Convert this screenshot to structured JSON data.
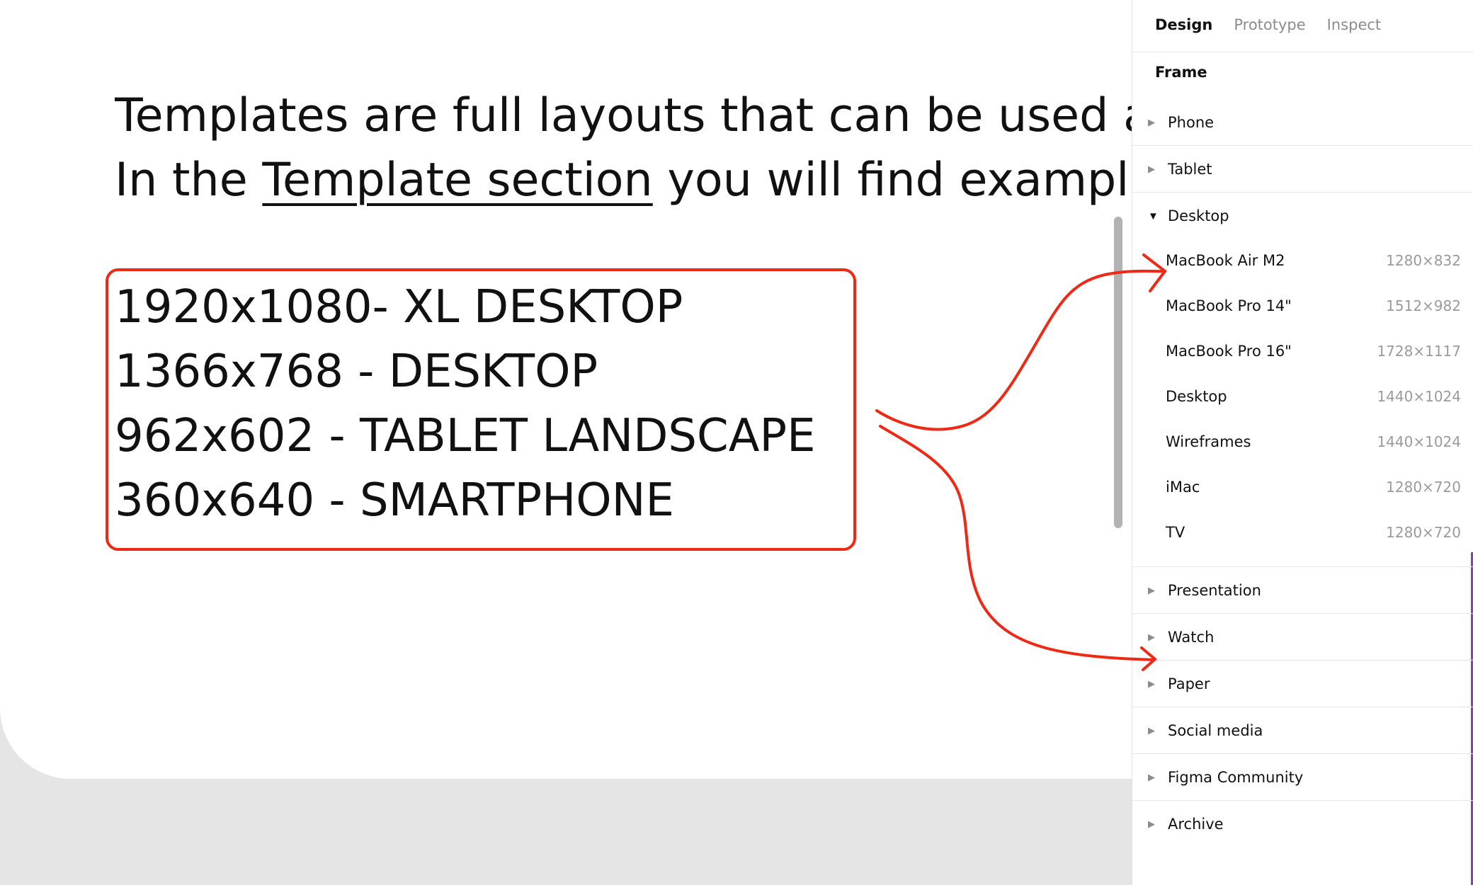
{
  "canvas": {
    "intro_line1": "Templates are full layouts that can be used as",
    "intro_line2_prefix": "In the ",
    "intro_link": "Template section",
    "intro_line2_suffix": " you will find examples",
    "resolutions": [
      "1920x1080- XL DESKTOP",
      "1366x768 - DESKTOP",
      "962x602 - TABLET LANDSCAPE",
      "360x640 - SMARTPHONE"
    ]
  },
  "panel": {
    "tabs": [
      "Design",
      "Prototype",
      "Inspect"
    ],
    "active_tab": "Design",
    "section_title": "Frame",
    "categories_top": [
      "Phone",
      "Tablet"
    ],
    "expanded_category": "Desktop",
    "presets": [
      {
        "name": "MacBook Air M2",
        "size": "1280×832"
      },
      {
        "name": "MacBook Pro 14\"",
        "size": "1512×982"
      },
      {
        "name": "MacBook Pro 16\"",
        "size": "1728×1117"
      },
      {
        "name": "Desktop",
        "size": "1440×1024"
      },
      {
        "name": "Wireframes",
        "size": "1440×1024"
      },
      {
        "name": "iMac",
        "size": "1280×720"
      },
      {
        "name": "TV",
        "size": "1280×720"
      }
    ],
    "categories_bottom": [
      "Presentation",
      "Watch",
      "Paper",
      "Social media",
      "Figma Community",
      "Archive"
    ]
  },
  "colors": {
    "annotation_red": "#ee2a16",
    "canvas_bg": "#e5e5e5",
    "accent_edge": "#7c4a9b"
  },
  "icons": {
    "collapsed_caret": "triangle-right",
    "expanded_caret": "triangle-down"
  }
}
